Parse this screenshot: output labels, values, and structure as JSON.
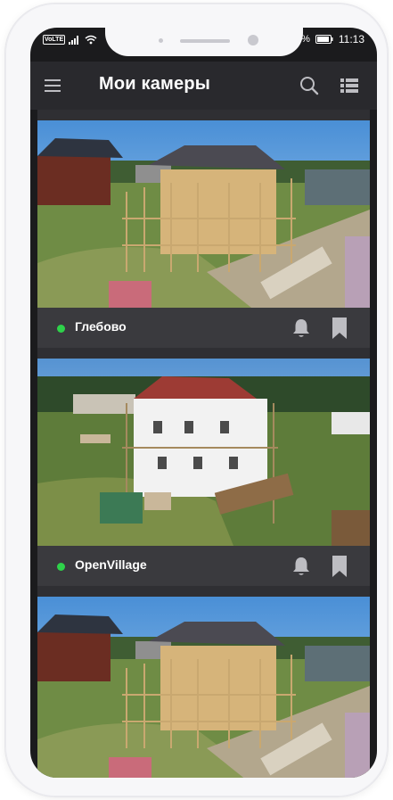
{
  "status_bar": {
    "network_badge": "VoLTE",
    "battery_percent": "%",
    "time": "11:13"
  },
  "app_bar": {
    "title": "Мои камеры",
    "icons": [
      "menu-icon",
      "search-icon",
      "list-view-icon"
    ]
  },
  "cameras": [
    {
      "name": "Глебово",
      "online": true,
      "status_color": "#2ed24a",
      "scene": "construction-site-dark-roof"
    },
    {
      "name": "OpenVillage",
      "online": true,
      "status_color": "#2ed24a",
      "scene": "construction-site-red-roof"
    },
    {
      "name": "",
      "online": true,
      "status_color": "#2ed24a",
      "scene": "construction-site-dark-roof"
    }
  ],
  "colors": {
    "background": "#1b1b1d",
    "app_bar": "#29292d",
    "card_footer": "#3a3a3e",
    "online_status": "#2ed24a"
  }
}
